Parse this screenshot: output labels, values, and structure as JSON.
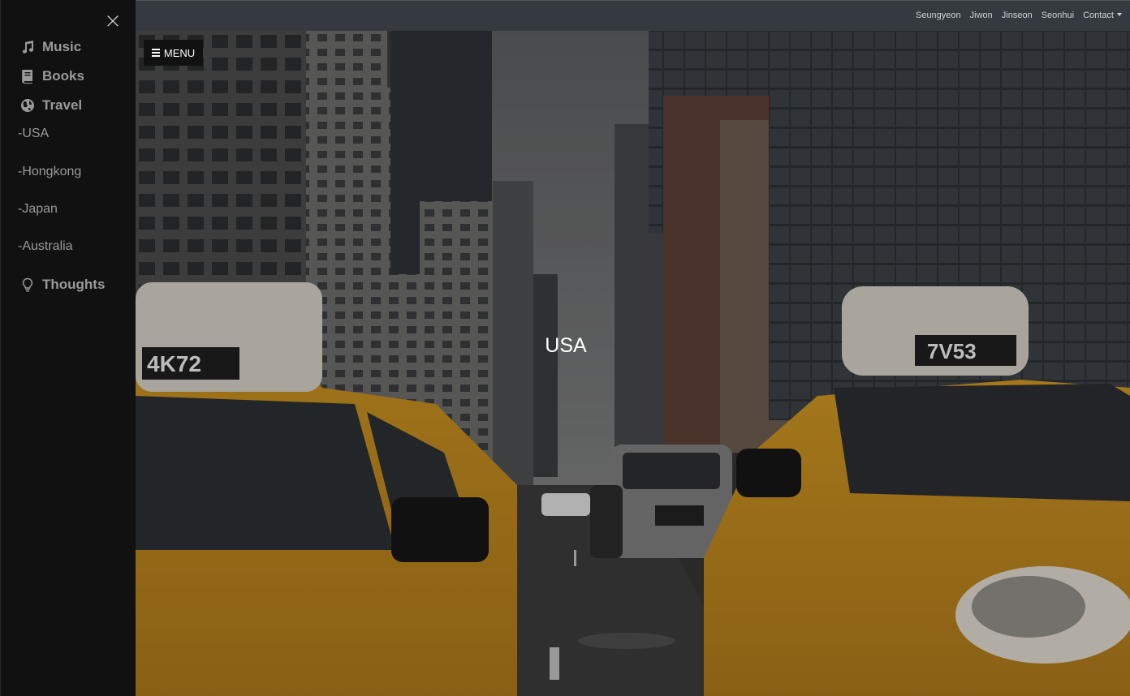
{
  "sidebar": {
    "close_icon": "close-icon",
    "items": [
      {
        "label": "Music",
        "icon": "music-note-icon"
      },
      {
        "label": "Books",
        "icon": "book-icon"
      },
      {
        "label": "Travel",
        "icon": "globe-icon"
      }
    ],
    "sub_items": [
      "-USA",
      "-Hongkong",
      "-Japan",
      "-Australia"
    ],
    "thoughts": {
      "label": "Thoughts",
      "icon": "lightbulb-icon"
    }
  },
  "topnav": {
    "links": [
      "Seungyeon",
      "Jiwon",
      "Jinseon",
      "Seonhui"
    ],
    "dropdown_label": "Contact"
  },
  "hero": {
    "menu_label": "MENU",
    "title": "USA",
    "taxi_left_plate": "4K72",
    "taxi_right_plate": "7V53"
  },
  "colors": {
    "sidebar_bg": "#111111",
    "topbar_bg": "#343a40",
    "taxi_yellow": "#d9a21c"
  }
}
